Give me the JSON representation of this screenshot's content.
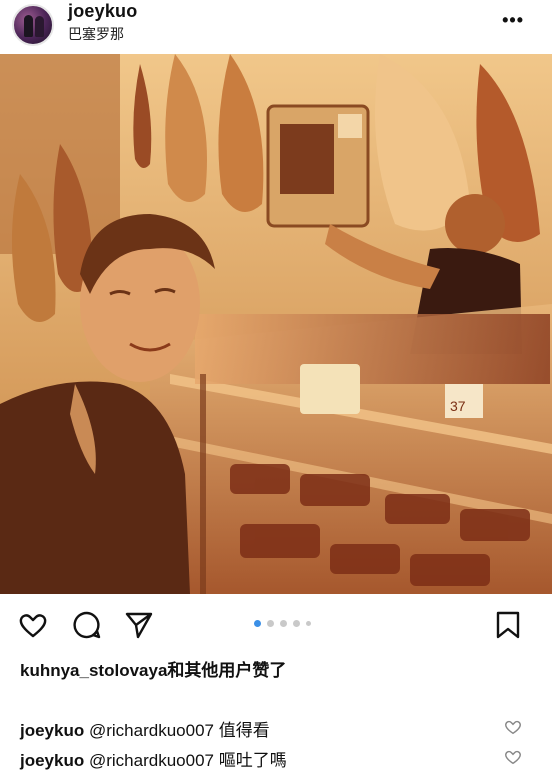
{
  "post": {
    "username": "joeykuo",
    "location": "巴塞罗那",
    "more_label": "•••"
  },
  "likes": {
    "first_liker": "kuhnya_stolovaya",
    "rest": "和其他用户赞了"
  },
  "comments": [
    {
      "user": "joeykuo",
      "mention": "@richardkuo007",
      "text": "值得看"
    },
    {
      "user": "joeykuo",
      "mention": "@richardkuo007",
      "text": "嘔吐了嗎"
    }
  ],
  "carousel": {
    "count": 5,
    "active_index": 0
  },
  "photo": {
    "price_tag_1": "37",
    "icons": [
      "heart-icon",
      "comment-icon",
      "share-icon",
      "bookmark-icon"
    ]
  },
  "colors": {
    "accent_dot": "#3b8fe6",
    "photo_tone": "#b87a3d"
  }
}
